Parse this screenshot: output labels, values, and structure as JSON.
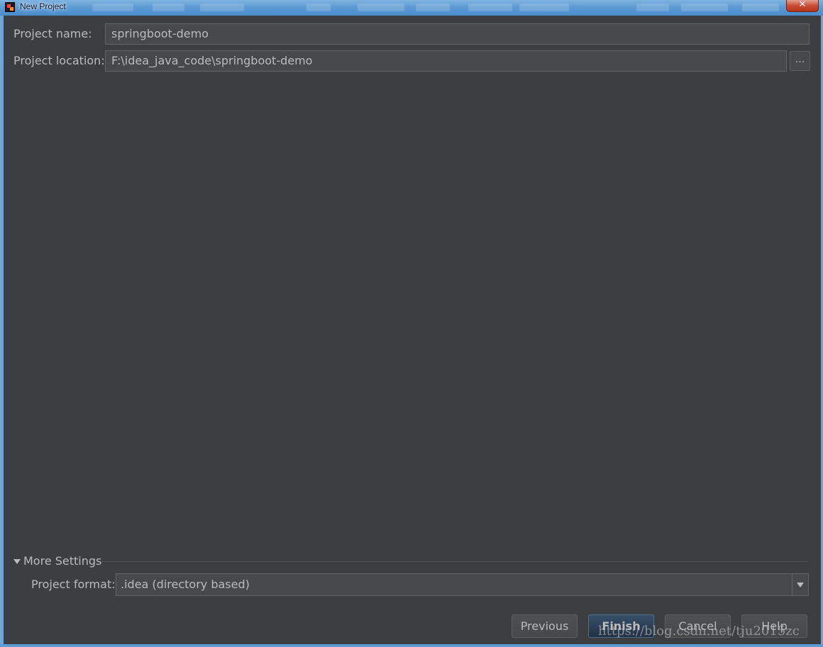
{
  "window": {
    "title": "New Project",
    "close_glyph": "✕",
    "icon": "intellij-app-icon"
  },
  "form": {
    "project_name_label": "Project name:",
    "project_name_value": "springboot-demo",
    "project_location_label": "Project location:",
    "project_location_value": "F:\\idea_java_code\\springboot-demo",
    "browse_label": "..."
  },
  "more_settings": {
    "toggle_label": "More Settings",
    "expanded": true,
    "project_format_label": "Project format:",
    "project_format_value": ".idea (directory based)"
  },
  "buttons": {
    "previous": "Previous",
    "finish": "Finish",
    "cancel": "Cancel",
    "help": "Help"
  },
  "watermark": "https://blog.csdn.net/tju2015zc",
  "colors": {
    "dialog_bg": "#3c3f41",
    "field_bg": "#45494a",
    "text": "#bbbbbb",
    "default_button_bg": "#2f4257",
    "titlebar": "#5d9bd3"
  }
}
